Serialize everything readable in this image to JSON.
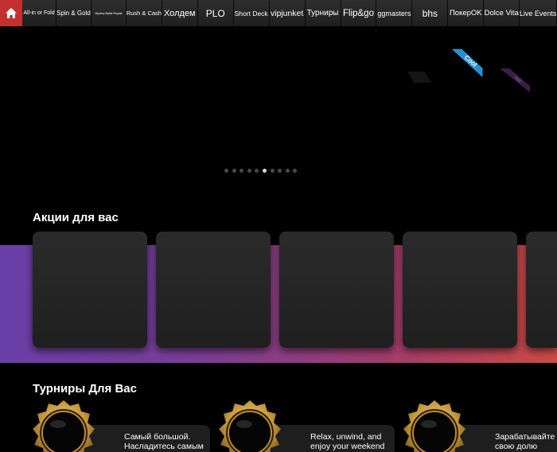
{
  "nav": {
    "tabs": [
      {
        "label": "All-in or Fold"
      },
      {
        "label": "Spin & Gold"
      },
      {
        "label": "Mystery Battle Royale"
      },
      {
        "label": "Rush & Cash"
      },
      {
        "label": "Холдем"
      },
      {
        "label": "PLO"
      },
      {
        "label": "Short Deck"
      },
      {
        "label": "vipjunket"
      },
      {
        "label": "Турниры"
      },
      {
        "label": "Flip&go"
      },
      {
        "label": "ggmasters"
      },
      {
        "label": "bhs"
      },
      {
        "label": "ПокерOK"
      },
      {
        "label": "Dolce Vita"
      },
      {
        "label": "Live Events"
      }
    ],
    "home_icon": "home-icon",
    "active_color": "#c42f2f"
  },
  "hero": {
    "ribbon_cool": "Cool",
    "ribbon_hot": "Hot",
    "slide_count": 10,
    "active_slide": 6
  },
  "promos": {
    "title": "Акции для вас",
    "cards": 5
  },
  "tournaments": {
    "title": "Турниры Для Вас",
    "items": [
      {
        "line1": "Самый большой.",
        "line2": "Насладитесь самым"
      },
      {
        "line1": "Relax, unwind, and",
        "line2": "enjoy your weekend"
      },
      {
        "line1": "Зарабатывайте",
        "line2": "свою долю"
      }
    ]
  }
}
